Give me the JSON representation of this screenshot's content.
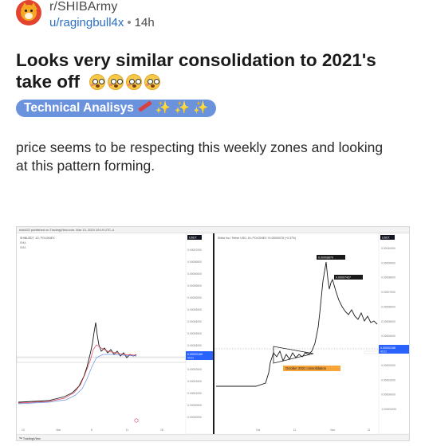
{
  "post": {
    "subreddit": "r/SHIBArmy",
    "username": "u/ragingbull4x",
    "separator": "•",
    "age": "14h",
    "title": "Looks very similar consolidation to 2021's take off",
    "title_emoji_count": 4,
    "title_emoji": "flushed-face",
    "flair": {
      "label": "Technical Analisys",
      "decoration": "✨ ✨ ✨",
      "bg_color": "#6b93dd"
    },
    "body": "price seems to be respecting this weekly zones and looking at this pattern forming."
  },
  "chart_image": {
    "header_text": "ricki422 published on TradingView.com, Mar 13, 2024 19:19 UTC-4",
    "left_symbol": "SHIBUSDT, 1D, POLONIEX",
    "left_lines": [
      "SMA",
      "SMA"
    ],
    "right_symbol": "Shiba Inu / Tether USD, 4h, POLONIEX +0.00000078 (+0.37%)",
    "left_axis_currency": "USDT",
    "right_axis_currency": "USDT",
    "left_price_tag": "0.00002189",
    "left_price_tag_sub": "40:22",
    "right_price_tag": "0.00002168",
    "right_price_tag_sub": "40:22",
    "peak_label": "0.00008870",
    "second_label": "0.00007437",
    "annotation": "October 2021 consolidation",
    "footer": "TradingView",
    "left_axis_ticks": [
      "0.00007000",
      "0.00006500",
      "0.00006000",
      "0.00005500",
      "0.00005000",
      "0.00004500",
      "0.00004000",
      "0.00003500",
      "0.00003000",
      "0.00002500",
      "0.00002000",
      "0.00001500",
      "0.00001000",
      "0.00000500",
      "0.00000000"
    ],
    "right_axis_ticks": [
      "0.00010000",
      "0.00009000",
      "0.00008000",
      "0.00007000",
      "0.00006000",
      "0.00005000",
      "0.00004000",
      "0.00003000",
      "0.00002000",
      "0.00001000",
      "0.00000000",
      "-0.00001000"
    ],
    "left_x_ticks": [
      "10",
      "Mar",
      "8",
      "11",
      "18"
    ],
    "right_x_ticks": [
      "Oct",
      "11",
      "Nov",
      "11"
    ],
    "colors": {
      "candle_up": "#111111",
      "ma_red": "#e0455a",
      "ma_blue": "#6b8ee0",
      "annotation_bg": "#f7a43a",
      "price_tag_bg": "#2962ff"
    }
  }
}
